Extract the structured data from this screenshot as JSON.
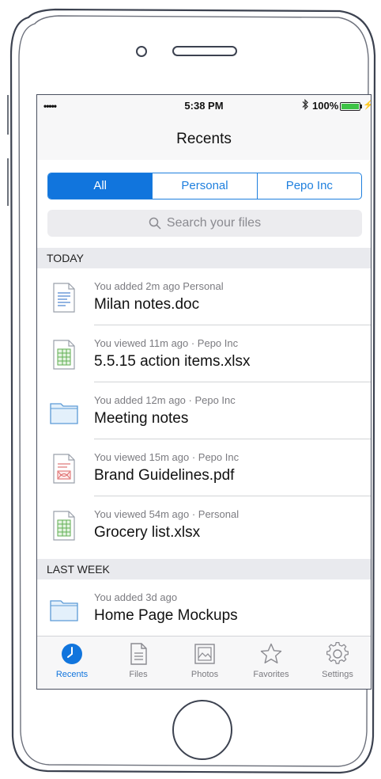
{
  "status_bar": {
    "signal": "•••••",
    "time": "5:38 PM",
    "battery_percent": "100%",
    "battery_level": 1.0,
    "battery_color": "#3ec346"
  },
  "nav": {
    "title": "Recents"
  },
  "segments": [
    {
      "label": "All",
      "active": true
    },
    {
      "label": "Personal",
      "active": false
    },
    {
      "label": "Pepo Inc",
      "active": false
    }
  ],
  "search": {
    "placeholder": "Search your files"
  },
  "sections": [
    {
      "title": "TODAY",
      "items": [
        {
          "meta": "You added 2m ago  Personal",
          "name": "Milan notes.doc",
          "icon": "word-doc-icon"
        },
        {
          "meta": "You viewed 11m ago · Pepo Inc",
          "name": "5.5.15 action items.xlsx",
          "icon": "spreadsheet-icon"
        },
        {
          "meta": "You added 12m ago · Pepo Inc",
          "name": "Meeting notes",
          "icon": "folder-icon"
        },
        {
          "meta": "You viewed 15m ago · Pepo Inc",
          "name": "Brand Guidelines.pdf",
          "icon": "pdf-icon"
        },
        {
          "meta": "You viewed 54m ago · Personal",
          "name": "Grocery list.xlsx",
          "icon": "spreadsheet-icon"
        }
      ]
    },
    {
      "title": "LAST WEEK",
      "items": [
        {
          "meta": "You added 3d ago",
          "name": "Home Page Mockups",
          "icon": "folder-icon"
        }
      ]
    }
  ],
  "tabs": [
    {
      "label": "Recents",
      "icon": "clock-icon",
      "active": true
    },
    {
      "label": "Files",
      "icon": "file-icon",
      "active": false
    },
    {
      "label": "Photos",
      "icon": "photo-icon",
      "active": false
    },
    {
      "label": "Favorites",
      "icon": "star-icon",
      "active": false
    },
    {
      "label": "Settings",
      "icon": "gear-icon",
      "active": false
    }
  ],
  "colors": {
    "accent": "#1175dd",
    "section_bg": "#e9eaee",
    "muted_text": "#7b7b80"
  }
}
